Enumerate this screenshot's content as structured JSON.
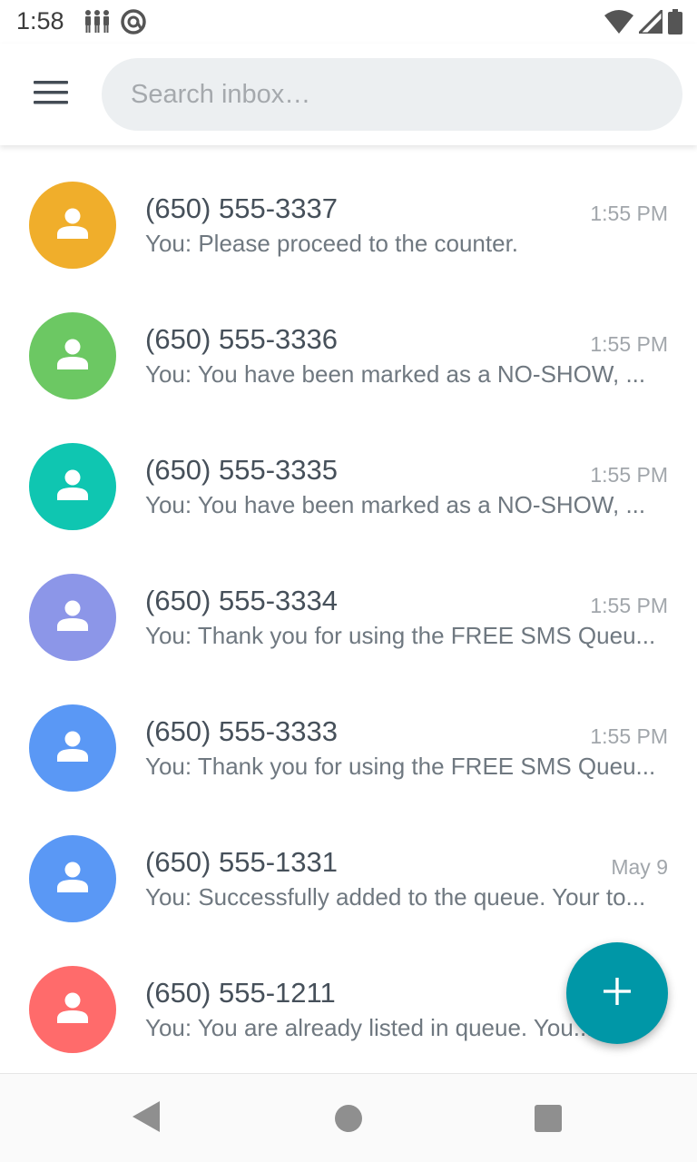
{
  "status_bar": {
    "time": "1:58",
    "left_icons": [
      "people-icon",
      "at-sign-icon"
    ],
    "right_icons": [
      "wifi-icon",
      "signal-icon",
      "battery-icon"
    ]
  },
  "app_bar": {
    "menu_icon": "hamburger-menu-icon",
    "search_placeholder": "Search inbox…",
    "search_value": ""
  },
  "conversations": [
    {
      "name": "(650) 555-3337",
      "time": "1:55 PM",
      "snippet": "You: Please proceed to the counter.",
      "avatar_color": "#f0ae2b"
    },
    {
      "name": "(650) 555-3336",
      "time": "1:55 PM",
      "snippet": "You: You have been marked as a NO-SHOW, ...",
      "avatar_color": "#6cc863"
    },
    {
      "name": "(650) 555-3335",
      "time": "1:55 PM",
      "snippet": "You: You have been marked as a NO-SHOW, ...",
      "avatar_color": "#0fc6b1"
    },
    {
      "name": "(650) 555-3334",
      "time": "1:55 PM",
      "snippet": "You: Thank you for using the FREE SMS Queu...",
      "avatar_color": "#8c96e8"
    },
    {
      "name": "(650) 555-3333",
      "time": "1:55 PM",
      "snippet": "You: Thank you for using the FREE SMS Queu...",
      "avatar_color": "#5a98f5"
    },
    {
      "name": "(650) 555-1331",
      "time": "May 9",
      "snippet": "You: Successfully added to the queue. Your to...",
      "avatar_color": "#5a98f5"
    },
    {
      "name": "(650) 555-1211",
      "time": "",
      "snippet": "You: You are already listed in queue. You...",
      "avatar_color": "#ff6b6b"
    }
  ],
  "fab": {
    "icon": "plus-icon",
    "color": "#0097a7"
  },
  "nav_bar": {
    "icons": [
      "back-icon",
      "home-icon",
      "recents-icon"
    ]
  }
}
